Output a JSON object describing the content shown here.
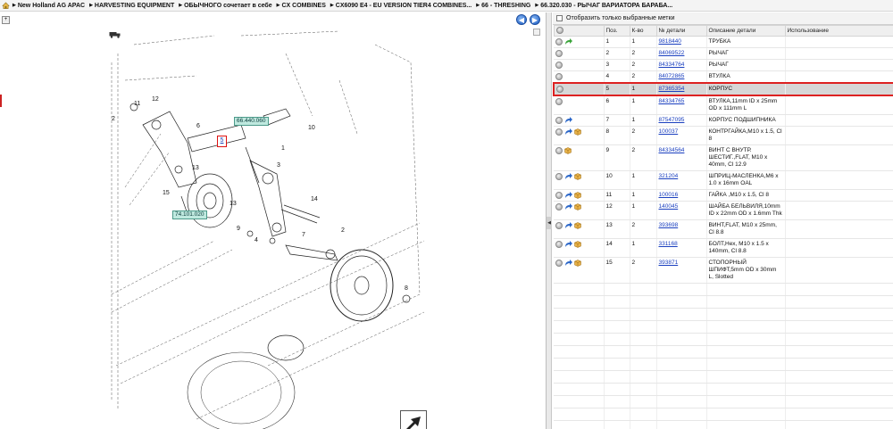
{
  "breadcrumbs": [
    "New Holland AG APAC",
    "HARVESTING EQUIPMENT",
    "ОБЫЧНОГО сочетает в себе",
    "CX COMBINES",
    "CX6090 E4 - EU VERSION TIER4 COMBINES...",
    "66 - THRESHING",
    "66.320.030 - РЫЧАГ ВАРИАТОРА БАРАБА..."
  ],
  "toolbar": {
    "nav_back": "◀",
    "nav_forward": "▶"
  },
  "drawing": {
    "tags": [
      {
        "id": "tag1",
        "text": "66.440.060"
      },
      {
        "id": "tag2",
        "text": "74.101.020"
      }
    ],
    "selected_callout": "5",
    "callouts": [
      "12",
      "11",
      "6",
      "10",
      "1",
      "2",
      "13",
      "3",
      "15",
      "14",
      "13",
      "9",
      "4",
      "7",
      "2",
      "8",
      "5"
    ]
  },
  "parts_panel": {
    "filter_label": "Отобразить только выбранные метки",
    "columns": [
      "",
      "Поз.",
      "К-во",
      "№ детали",
      "Описание детали",
      "Использование"
    ],
    "rows": [
      {
        "pos": "1",
        "qty": "1",
        "part": "9818440",
        "desc": "ТРУБКА",
        "icons": [
          "info",
          "arrow-green"
        ]
      },
      {
        "pos": "2",
        "qty": "2",
        "part": "84069522",
        "desc": "РЫЧАГ",
        "icons": [
          "info"
        ]
      },
      {
        "pos": "3",
        "qty": "2",
        "part": "84334764",
        "desc": "РЫЧАГ",
        "icons": [
          "info"
        ]
      },
      {
        "pos": "4",
        "qty": "2",
        "part": "84072865",
        "desc": "ВТУЛКА",
        "icons": [
          "info"
        ]
      },
      {
        "pos": "5",
        "qty": "1",
        "part": "87365354",
        "desc": "КОРПУС",
        "icons": [
          "info"
        ],
        "selected": true
      },
      {
        "pos": "6",
        "qty": "1",
        "part": "84334765",
        "desc": "ВТУЛКА,11mm ID x 25mm OD x 111mm L",
        "icons": [
          "info"
        ]
      },
      {
        "pos": "7",
        "qty": "1",
        "part": "87547095",
        "desc": "КОРПУС ПОДШИПНИКА",
        "icons": [
          "info",
          "arrow-blue"
        ]
      },
      {
        "pos": "8",
        "qty": "2",
        "part": "100037",
        "desc": "КОНТРГАЙКА,M10 x 1.5, Cl 8",
        "icons": [
          "info",
          "arrow-blue",
          "box"
        ]
      },
      {
        "pos": "9",
        "qty": "2",
        "part": "84334564",
        "desc": "ВИНТ С ВНУТР. ШЕСТИГ.,FLAT, M10 x 40mm, Cl 12.9",
        "icons": [
          "info",
          "box"
        ]
      },
      {
        "pos": "10",
        "qty": "1",
        "part": "321204",
        "desc": "ШПРИЦ-МАСЛЕНКА,M6 x 1.0 x 16mm OAL",
        "icons": [
          "info",
          "arrow-blue",
          "box"
        ]
      },
      {
        "pos": "11",
        "qty": "1",
        "part": "100016",
        "desc": "ГАЙКА ,M10 x 1.5, Cl 8",
        "icons": [
          "info",
          "arrow-blue",
          "box"
        ]
      },
      {
        "pos": "12",
        "qty": "1",
        "part": "140045",
        "desc": "ШАЙБА БЕЛЬВИЛЯ,10mm ID x 22mm OD x 1.6mm Thk",
        "icons": [
          "info",
          "arrow-blue",
          "box"
        ]
      },
      {
        "pos": "13",
        "qty": "2",
        "part": "393698",
        "desc": "ВИНТ,FLAT, M10 x 25mm, Cl 8.8",
        "icons": [
          "info",
          "arrow-blue",
          "box"
        ]
      },
      {
        "pos": "14",
        "qty": "1",
        "part": "331168",
        "desc": "БОЛТ,Hex, M10 x 1.5 x 140mm, Cl 8.8",
        "icons": [
          "info",
          "arrow-blue",
          "box"
        ]
      },
      {
        "pos": "15",
        "qty": "2",
        "part": "393871",
        "desc": "СТОПОРНЫЙ ШПИФТ,5mm OD x 30mm L, Slotted",
        "icons": [
          "info",
          "arrow-blue",
          "box"
        ]
      }
    ]
  },
  "colors": {
    "selection_border": "#dd2222",
    "tag_bg": "#bfe9df",
    "link": "#1a3fbf",
    "nav_blue": "#1f5fc4"
  }
}
